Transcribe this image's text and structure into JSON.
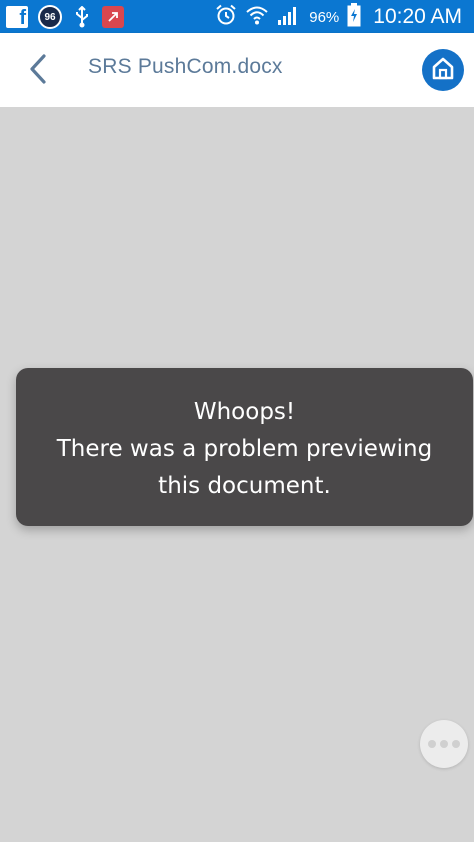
{
  "status_bar": {
    "notification_badge": "96",
    "battery_percent": "96%",
    "time": "10:20 AM",
    "icons": [
      "facebook-icon",
      "notification-96-icon",
      "usb-icon",
      "app-notification-icon",
      "alarm-icon",
      "wifi-icon",
      "signal-icon",
      "battery-charging-icon"
    ],
    "background_color": "#0b77d1"
  },
  "header": {
    "title": "SRS PushCom.docx",
    "back_icon": "chevron-left-icon",
    "home_icon": "home-icon",
    "title_color": "#5c7a99",
    "home_color": "#1471c7"
  },
  "preview": {
    "error": {
      "line1": "Whoops!",
      "line2": "There was a problem previewing",
      "line3": "this document."
    },
    "more_icon": "more-horizontal-icon",
    "background_color": "#d4d4d4"
  }
}
